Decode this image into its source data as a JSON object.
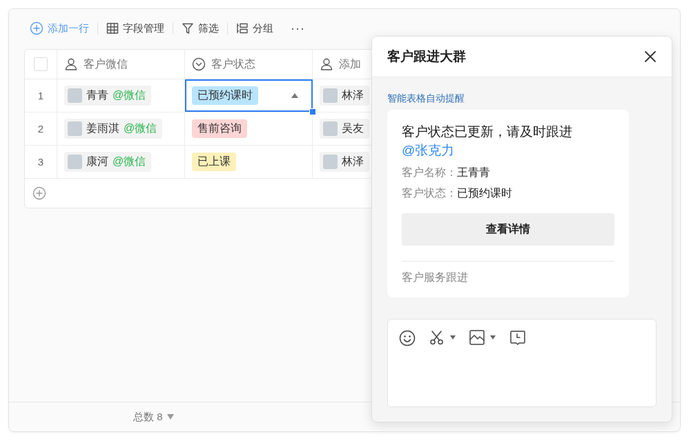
{
  "toolbar": [
    {
      "kind": "add",
      "label": "添加一行"
    },
    {
      "kind": "fields",
      "label": "字段管理"
    },
    {
      "kind": "filter",
      "label": "筛选"
    },
    {
      "kind": "group",
      "label": "分组"
    },
    {
      "kind": "more",
      "label": "···"
    }
  ],
  "table": {
    "select_all": {
      "checked": false
    },
    "columns": [
      {
        "kind": "person",
        "label": "客户微信"
      },
      {
        "kind": "status",
        "label": "客户状态"
      },
      {
        "kind": "person",
        "label": "添加"
      }
    ],
    "rows": [
      {
        "number": "1",
        "customer": {
          "name": "青青",
          "suffix": "@微信"
        },
        "status": {
          "label": "已预约课时",
          "color": "#b8e4fd",
          "selected": true
        },
        "adder": "林泽"
      },
      {
        "number": "2",
        "customer": {
          "name": "姜雨淇",
          "suffix": "@微信"
        },
        "status": {
          "label": "售前咨询",
          "color": "#fdd5d5",
          "selected": false
        },
        "adder": "吴友"
      },
      {
        "number": "3",
        "customer": {
          "name": "康河",
          "suffix": "@微信"
        },
        "status": {
          "label": "已上课",
          "color": "#fdf0b9",
          "selected": false
        },
        "adder": "林泽"
      }
    ]
  },
  "footer": {
    "total": "总数 8"
  },
  "panel": {
    "title": "客户跟进大群",
    "source": "智能表格自动提醒",
    "message": {
      "title": "客户状态已更新，请及时跟进",
      "mention": "@张克力",
      "fields": [
        {
          "label": "客户名称：",
          "value": "王青青"
        },
        {
          "label": "客户状态：",
          "value": "已预约课时"
        }
      ],
      "button": "查看详情",
      "footer": "客户服务跟进"
    },
    "composer_tools": [
      {
        "kind": "emoji"
      },
      {
        "kind": "screenshot"
      },
      {
        "kind": "image"
      },
      {
        "kind": "schedule"
      }
    ]
  }
}
